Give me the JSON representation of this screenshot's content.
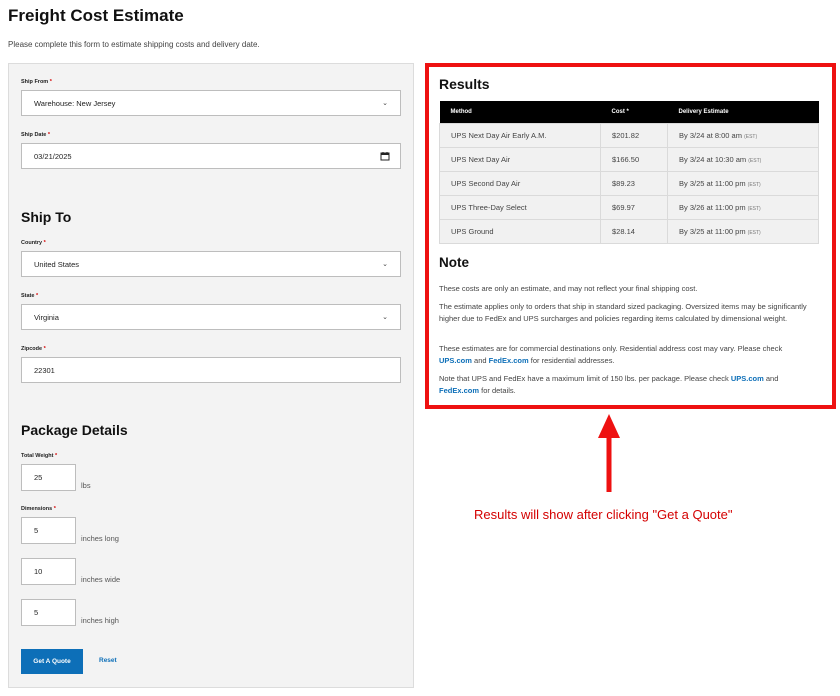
{
  "page": {
    "title": "Freight Cost Estimate",
    "intro": "Please complete this form to estimate shipping costs and delivery date."
  },
  "required_mark": "*",
  "form": {
    "ship_from_label": "Ship From",
    "ship_from_value": "Warehouse: New Jersey",
    "ship_date_label": "Ship Date",
    "ship_date_value": "03/21/2025",
    "ship_to_title": "Ship To",
    "country_label": "Country",
    "country_value": "United States",
    "state_label": "State",
    "state_value": "Virginia",
    "zipcode_label": "Zipcode",
    "zipcode_value": "22301",
    "package_title": "Package Details",
    "weight_label": "Total Weight",
    "weight_value": "25",
    "weight_unit": "lbs",
    "dimensions_label": "Dimensions",
    "length_value": "5",
    "length_unit": "inches long",
    "width_value": "10",
    "width_unit": "inches wide",
    "height_value": "5",
    "height_unit": "inches high",
    "quote_button": "Get A Quote",
    "reset_link": "Reset"
  },
  "results": {
    "title": "Results",
    "headers": {
      "method": "Method",
      "cost": "Cost *",
      "delivery": "Delivery Estimate"
    },
    "rows": [
      {
        "method": "UPS Next Day Air Early A.M.",
        "cost": "$201.82",
        "delivery": "By 3/24 at 8:00 am",
        "tz": "(EST)"
      },
      {
        "method": "UPS Next Day Air",
        "cost": "$166.50",
        "delivery": "By 3/24 at 10:30 am",
        "tz": "(EST)"
      },
      {
        "method": "UPS Second Day Air",
        "cost": "$89.23",
        "delivery": "By 3/25 at 11:00 pm",
        "tz": "(EST)"
      },
      {
        "method": "UPS Three-Day Select",
        "cost": "$69.97",
        "delivery": "By 3/26 at 11:00 pm",
        "tz": "(EST)"
      },
      {
        "method": "UPS Ground",
        "cost": "$28.14",
        "delivery": "By 3/25 at 11:00 pm",
        "tz": "(EST)"
      }
    ]
  },
  "note": {
    "title": "Note",
    "p1": "These costs are only an estimate, and may not reflect your final shipping cost.",
    "p2": "The estimate applies only to orders that ship in standard sized packaging. Oversized items may be significantly higher due to FedEx and UPS surcharges and policies regarding items calculated by dimensional weight.",
    "p3_a": "These estimates are for commercial destinations only. Residential address cost may vary. Please check",
    "ups_link": "UPS.com",
    "and": "and",
    "fedex_link": "FedEx.com",
    "p3_b": "for residential addresses.",
    "p4_a": "Note that UPS and FedEx have a maximum limit of 150 lbs. per package. Please check",
    "p4_b": "for details."
  },
  "annotation": {
    "caption": "Results will show after clicking \"Get a Quote\"",
    "color": "#ee1111"
  },
  "colors": {
    "accent": "#0d6fb8",
    "highlight": "#ee1111",
    "table_header": "#000000"
  }
}
